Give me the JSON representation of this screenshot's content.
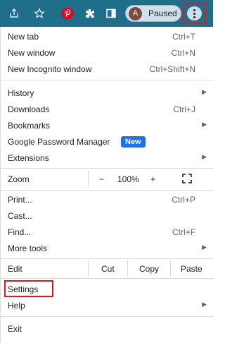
{
  "profile": {
    "avatar_letter": "A",
    "status": "Paused"
  },
  "toolbar_icons": [
    "share-icon",
    "star-icon",
    "pinterest-icon",
    "extensions-icon",
    "side-panel-icon"
  ],
  "menu": {
    "new_tab": {
      "label": "New tab",
      "shortcut": "Ctrl+T"
    },
    "new_window": {
      "label": "New window",
      "shortcut": "Ctrl+N"
    },
    "new_incognito": {
      "label": "New Incognito window",
      "shortcut": "Ctrl+Shift+N"
    },
    "history": {
      "label": "History"
    },
    "downloads": {
      "label": "Downloads",
      "shortcut": "Ctrl+J"
    },
    "bookmarks": {
      "label": "Bookmarks"
    },
    "password_manager": {
      "label": "Google Password Manager",
      "badge": "New"
    },
    "extensions": {
      "label": "Extensions"
    },
    "zoom": {
      "label": "Zoom",
      "minus": "−",
      "value": "100%",
      "plus": "+"
    },
    "print": {
      "label": "Print...",
      "shortcut": "Ctrl+P"
    },
    "cast": {
      "label": "Cast..."
    },
    "find": {
      "label": "Find...",
      "shortcut": "Ctrl+F"
    },
    "more_tools": {
      "label": "More tools"
    },
    "edit": {
      "label": "Edit",
      "cut": "Cut",
      "copy": "Copy",
      "paste": "Paste"
    },
    "settings": {
      "label": "Settings"
    },
    "help": {
      "label": "Help"
    },
    "exit": {
      "label": "Exit"
    }
  },
  "colors": {
    "toolbar": "#1f6f8b",
    "highlight": "#e0191f",
    "badge": "#1a73e8"
  }
}
